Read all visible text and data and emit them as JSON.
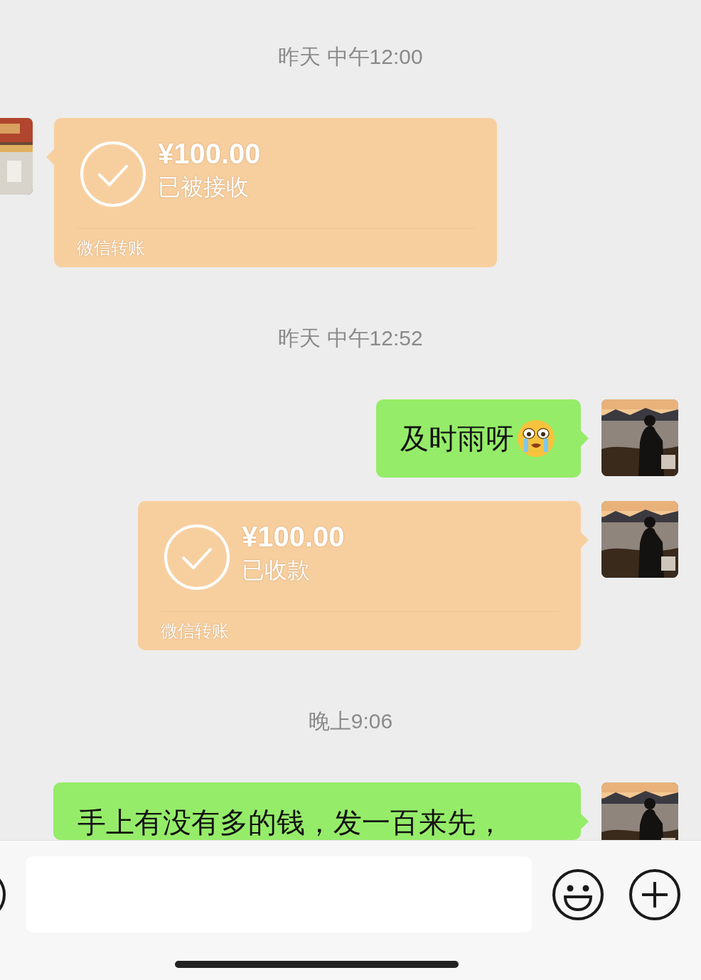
{
  "messages": [
    {
      "kind": "time",
      "text": "昨天 中午12:00"
    },
    {
      "kind": "transfer",
      "from_me": false,
      "amount": "¥100.00",
      "status": "已被接收",
      "footer": "微信转账"
    },
    {
      "kind": "time",
      "text": "昨天 中午12:52"
    },
    {
      "kind": "text",
      "from_me": true,
      "text": "及时雨呀",
      "trailing_emoji": true
    },
    {
      "kind": "transfer",
      "from_me": true,
      "amount": "¥100.00",
      "status": "已收款",
      "footer": "微信转账"
    },
    {
      "kind": "time",
      "text": "晚上9:06"
    },
    {
      "kind": "text",
      "from_me": true,
      "text": "手上有没有多的钱，发一百来先，",
      "trailing_emoji": false
    }
  ]
}
